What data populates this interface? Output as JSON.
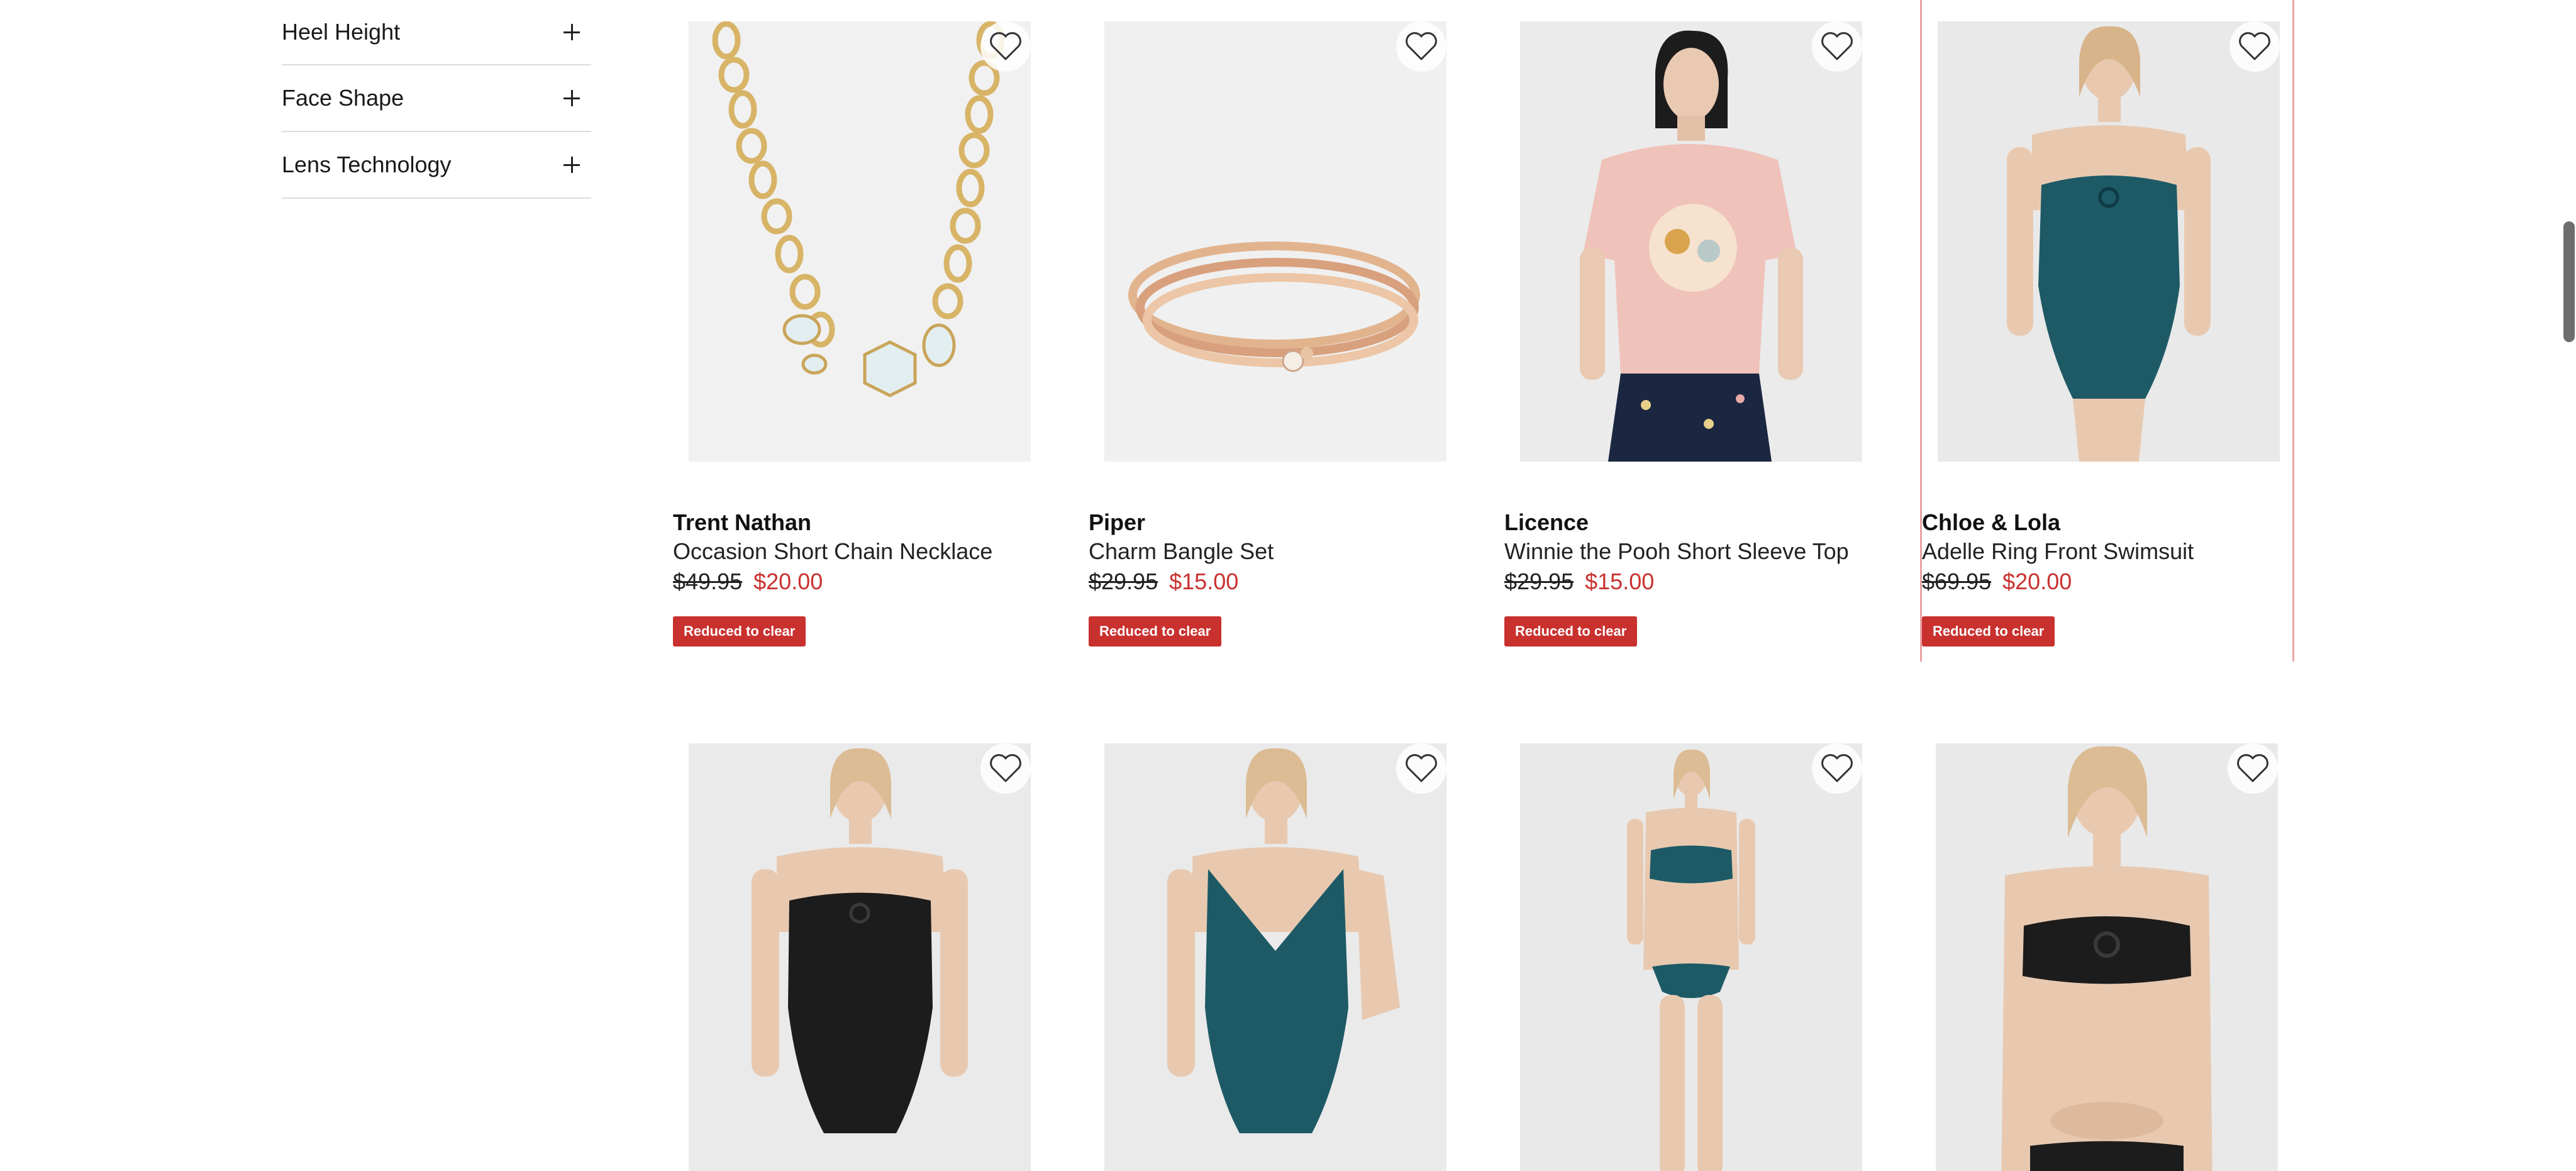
{
  "filters": [
    {
      "label": "Heel Height",
      "icon": "plus-icon"
    },
    {
      "label": "Face Shape",
      "icon": "plus-icon"
    },
    {
      "label": "Lens Technology",
      "icon": "plus-icon"
    }
  ],
  "colors": {
    "sale_red": "#c8312e",
    "highlight_border": "#e8a3a3",
    "divider": "#dcdcdc",
    "teal_swim": "#1d5a66",
    "black_swim": "#1c1c1c"
  },
  "products": [
    {
      "brand": "Trent Nathan",
      "name": "Occasion Short Chain Necklace",
      "was_price": "$49.95",
      "now_price": "$20.00",
      "badge": "Reduced to clear",
      "image": "gold-chain-necklace"
    },
    {
      "brand": "Piper",
      "name": "Charm Bangle Set",
      "was_price": "$29.95",
      "now_price": "$15.00",
      "badge": "Reduced to clear",
      "image": "gold-bangle-set"
    },
    {
      "brand": "Licence",
      "name": "Winnie the Pooh Short Sleeve Top",
      "was_price": "$29.95",
      "now_price": "$15.00",
      "badge": "Reduced to clear",
      "image": "pink-pooh-tee"
    },
    {
      "brand": "Chloe & Lola",
      "name": "Adelle Ring Front Swimsuit",
      "was_price": "$69.95",
      "now_price": "$20.00",
      "badge": "Reduced to clear",
      "image": "teal-halter-swimsuit"
    },
    {
      "image": "black-halter-swimsuit"
    },
    {
      "image": "teal-v-neck-swimsuit"
    },
    {
      "image": "teal-bikini"
    },
    {
      "image": "black-bikini"
    }
  ],
  "icons": {
    "wishlist": "heart-outline-icon"
  }
}
